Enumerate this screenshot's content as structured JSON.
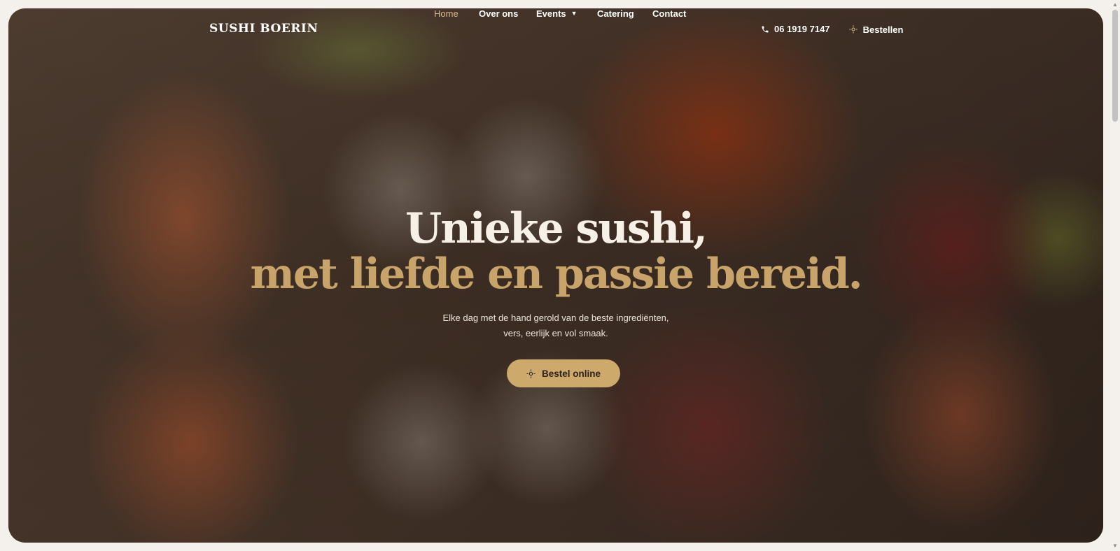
{
  "brand": {
    "logo_text": "SUSHI BOERIN"
  },
  "nav": {
    "items": [
      {
        "label": "Home",
        "active": true
      },
      {
        "label": "Over ons",
        "active": false
      },
      {
        "label": "Events",
        "active": false,
        "has_dropdown": true
      },
      {
        "label": "Catering",
        "active": false
      },
      {
        "label": "Contact",
        "active": false
      }
    ],
    "phone": "06 1919 7147",
    "order_button": "Bestellen"
  },
  "hero": {
    "title_line1": "Unieke sushi,",
    "title_line2": "met liefde en passie bereid.",
    "subtitle_line1": "Elke dag met de hand gerold van de beste ingrediënten,",
    "subtitle_line2": "vers, eerlijk en vol smaak.",
    "cta_label": "Bestel online"
  },
  "colors": {
    "accent": "#cda96c",
    "accent_text": "#c9a46a",
    "active_nav": "#d7bb86",
    "title": "#f6f0e6"
  },
  "icons": {
    "phone": "phone-icon",
    "order": "sun-icon",
    "cta": "sun-icon",
    "dropdown": "caret-down-icon"
  }
}
